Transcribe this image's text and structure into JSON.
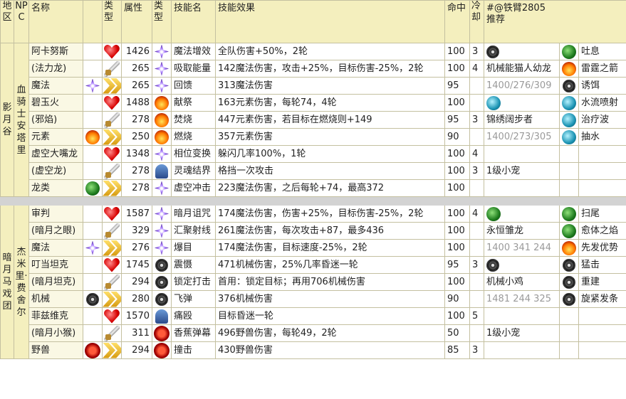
{
  "headers": {
    "area": "地区",
    "npc": "NPC",
    "name": "名称",
    "type": "类型",
    "attr": "属性",
    "skill_type": "类型",
    "skill_name": "技能名",
    "effect": "技能效果",
    "hit": "命中",
    "cooldown": "冷却",
    "recommend_line1": "#@铁臂2805",
    "recommend_line2": "推荐"
  },
  "sections": [
    {
      "area": "影月谷",
      "npc": "血骑士安塔里",
      "groups": [
        {
          "rec_type": "icons",
          "rec_icons_left": [
            "gear-icon"
          ],
          "rows": [
            {
              "name": "阿卡努斯",
              "name_icon": "",
              "type_icon": "heart-icon",
              "attr": "1426",
              "skill_icon": "arcane-icon",
              "skill": "魔法增效",
              "effect": "全队伤害+50%，2轮",
              "hit": "100",
              "cd": "3",
              "rec": "",
              "rec_icon": "gear-icon",
              "rec2": "吐息",
              "rec2_icon": "dragon-icon"
            },
            {
              "name": "(法力龙)",
              "name_icon": "",
              "type_icon": "sword-icon",
              "attr": "265",
              "skill_icon": "arcane-icon",
              "skill": "吸取能量",
              "effect": "142魔法伤害，攻击+25%，目标伤害-25%，2轮",
              "hit": "100",
              "cd": "4",
              "rec": "机械能猫人幼龙",
              "rec_icon": "",
              "rec2": "雷霆之箭",
              "rec2_icon": "fire-icon"
            },
            {
              "name": "魔法",
              "name_icon": "arcane-icon",
              "type_icon": "chevron-icon",
              "attr": "265",
              "skill_icon": "arcane-icon",
              "skill": "回馈",
              "effect": "313魔法伤害",
              "hit": "95",
              "cd": "",
              "rec": "1400/276/309",
              "rec_muted": true,
              "rec_icon": "",
              "rec2": "诱饵",
              "rec2_icon": "gear-icon"
            }
          ]
        },
        {
          "rows": [
            {
              "name": "碧玉火",
              "name_icon": "",
              "type_icon": "heart-icon",
              "attr": "1488",
              "skill_icon": "fire-icon",
              "skill": "献祭",
              "effect": "163元素伤害，每轮74，4轮",
              "hit": "100",
              "cd": "",
              "rec": "",
              "rec_icon": "aqua-icon",
              "rec2": "水流喷射",
              "rec2_icon": "aqua-icon"
            },
            {
              "name": "(邪焰)",
              "name_icon": "",
              "type_icon": "sword-icon",
              "attr": "278",
              "skill_icon": "fire-icon",
              "skill": "焚烧",
              "effect": "447元素伤害，若目标在燃烧则+149",
              "hit": "95",
              "cd": "3",
              "rec": "锦绣阔步者",
              "rec_icon": "",
              "rec2": "治疗波",
              "rec2_icon": "aqua-icon"
            },
            {
              "name": "元素",
              "name_icon": "fire-icon",
              "type_icon": "chevron-icon",
              "attr": "250",
              "skill_icon": "fire-icon",
              "skill": "燃烧",
              "effect": "357元素伤害",
              "hit": "90",
              "cd": "",
              "rec": "1400/273/305",
              "rec_muted": true,
              "rec_icon": "",
              "rec2": "抽水",
              "rec2_icon": "aqua-icon"
            }
          ]
        },
        {
          "rows": [
            {
              "name": "虚空大嘴龙",
              "name_icon": "",
              "type_icon": "heart-icon",
              "attr": "1348",
              "skill_icon": "arcane-icon",
              "skill": "相位变换",
              "effect": "躲闪几率100%，1轮",
              "hit": "100",
              "cd": "4",
              "rec": "",
              "rec_icon": "",
              "rec2": "",
              "rec2_icon": ""
            },
            {
              "name": "(虚空龙)",
              "name_icon": "",
              "type_icon": "sword-icon",
              "attr": "278",
              "skill_icon": "helm-icon",
              "skill": "灵魂结界",
              "effect": "格挡一次攻击",
              "hit": "100",
              "cd": "3",
              "rec": "1级小宠",
              "rec_icon": "",
              "rec2": "",
              "rec2_icon": ""
            },
            {
              "name": "龙类",
              "name_icon": "dragon-icon",
              "type_icon": "chevron-icon",
              "attr": "278",
              "skill_icon": "arcane-icon",
              "skill": "虚空冲击",
              "effect": "223魔法伤害，之后每轮+74，最高372",
              "hit": "100",
              "cd": "",
              "rec": "",
              "rec_icon": "",
              "rec2": "",
              "rec2_icon": ""
            }
          ]
        }
      ]
    },
    {
      "area": "暗月马戏团",
      "npc": "杰米里·费舍尔",
      "groups": [
        {
          "rows": [
            {
              "name": "审判",
              "name_icon": "",
              "type_icon": "heart-icon",
              "attr": "1587",
              "skill_icon": "arcane-icon",
              "skill": "暗月诅咒",
              "effect": "174魔法伤害，伤害+25%，目标伤害-25%，2轮",
              "hit": "100",
              "cd": "4",
              "rec": "",
              "rec_icon": "dragon-icon",
              "rec2": "扫尾",
              "rec2_icon": "dragon-icon"
            },
            {
              "name": "(暗月之眼)",
              "name_icon": "",
              "type_icon": "sword-icon",
              "attr": "329",
              "skill_icon": "arcane-icon",
              "skill": "汇聚射线",
              "effect": "261魔法伤害，每次攻击+87，最多436",
              "hit": "100",
              "cd": "",
              "rec": "永恒雏龙",
              "rec_icon": "",
              "rec2": "愈体之焰",
              "rec2_icon": "dragon-icon"
            },
            {
              "name": "魔法",
              "name_icon": "arcane-icon",
              "type_icon": "chevron-icon",
              "attr": "276",
              "skill_icon": "arcane-icon",
              "skill": "爆目",
              "effect": "174魔法伤害，目标速度-25%，2轮",
              "hit": "100",
              "cd": "",
              "rec": "1400 341 244",
              "rec_muted": true,
              "rec_icon": "",
              "rec2": "先发优势",
              "rec2_icon": "fire-icon"
            }
          ]
        },
        {
          "rows": [
            {
              "name": "叮当坦克",
              "name_icon": "",
              "type_icon": "heart-icon",
              "attr": "1745",
              "skill_icon": "gear-icon",
              "skill": "震慑",
              "effect": "471机械伤害，25%几率昏迷一轮",
              "hit": "95",
              "cd": "3",
              "rec": "",
              "rec_icon": "gear-icon",
              "rec2": "猛击",
              "rec2_icon": "gear-icon"
            },
            {
              "name": "(暗月坦克)",
              "name_icon": "",
              "type_icon": "sword-icon",
              "attr": "294",
              "skill_icon": "gear-icon",
              "skill": "锁定打击",
              "effect": "首用：锁定目标；再用706机械伤害",
              "hit": "100",
              "cd": "",
              "rec": "机械小鸡",
              "rec_icon": "",
              "rec2": "重建",
              "rec2_icon": "gear-icon"
            },
            {
              "name": "机械",
              "name_icon": "gear-icon",
              "type_icon": "chevron-icon",
              "attr": "280",
              "skill_icon": "gear-icon",
              "skill": "飞弹",
              "effect": "376机械伤害",
              "hit": "90",
              "cd": "",
              "rec": "1481 244 325",
              "rec_muted": true,
              "rec_icon": "",
              "rec2": "旋紧发条",
              "rec2_icon": "gear-icon"
            }
          ]
        },
        {
          "rows": [
            {
              "name": "菲兹维克",
              "name_icon": "",
              "type_icon": "heart-icon",
              "attr": "1570",
              "skill_icon": "helm-icon",
              "skill": "痛殴",
              "effect": "目标昏迷一轮",
              "hit": "100",
              "cd": "5",
              "rec": "",
              "rec_icon": "",
              "rec2": "",
              "rec2_icon": ""
            },
            {
              "name": "(暗月小猴)",
              "name_icon": "",
              "type_icon": "sword-icon",
              "attr": "311",
              "skill_icon": "paw-icon",
              "skill": "香蕉弹幕",
              "effect": "496野兽伤害，每轮49，2轮",
              "hit": "50",
              "cd": "",
              "rec": "1级小宠",
              "rec_icon": "",
              "rec2": "",
              "rec2_icon": ""
            },
            {
              "name": "野兽",
              "name_icon": "paw-icon",
              "type_icon": "chevron-icon",
              "attr": "294",
              "skill_icon": "paw-icon",
              "skill": "撞击",
              "effect": "430野兽伤害",
              "hit": "85",
              "cd": "3",
              "rec": "",
              "rec_icon": "",
              "rec2": "",
              "rec2_icon": ""
            }
          ]
        }
      ]
    }
  ]
}
